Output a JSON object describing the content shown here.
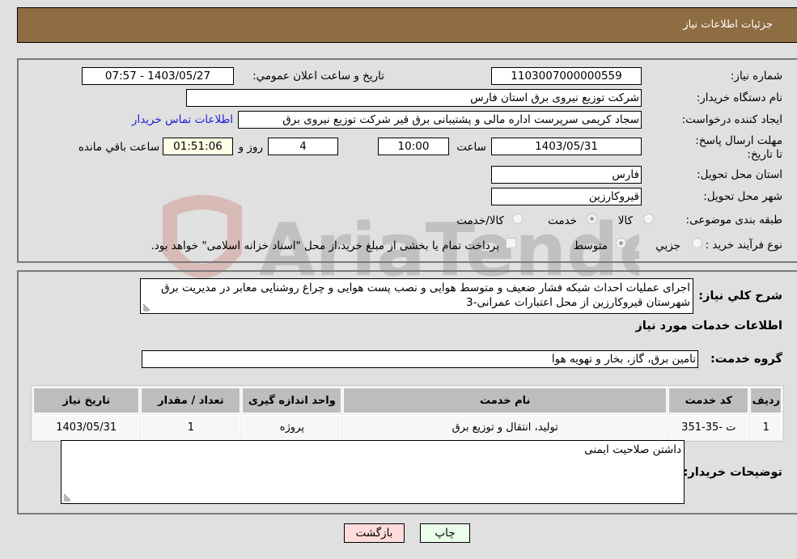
{
  "header": {
    "title": "جزئیات اطلاعات نیاز"
  },
  "form": {
    "need_number_label": "شماره نیاز:",
    "need_number": "1103007000000559",
    "announce_label": "تاريخ و ساعت اعلان عمومي:",
    "announce_value": "1403/05/27 - 07:57",
    "buyer_org_label": "نام دستگاه خریدار:",
    "buyer_org": "شرکت توزیع نیروی برق استان فارس",
    "creator_label": "ایجاد کننده درخواست:",
    "creator": "سجاد کریمی سرپرست اداره مالی و پشتیبانی برق قیر شرکت توزیع نیروی برق",
    "contact_link": "اطلاعات تماس خریدار",
    "deadline_label": "مهلت ارسال پاسخ: تا تاریخ:",
    "deadline_date": "1403/05/31",
    "time_label": "ساعت",
    "deadline_time": "10:00",
    "days_value": "4",
    "days_label": "روز و",
    "remaining_time": "01:51:06",
    "remaining_label": "ساعت باقي مانده",
    "province_label": "استان محل تحویل:",
    "province": "فارس",
    "city_label": "شهر محل تحویل:",
    "city": "قیروکارزین",
    "category_label": "طبقه بندی موضوعی:",
    "category_options": [
      {
        "label": "کالا",
        "checked": false
      },
      {
        "label": "خدمت",
        "checked": true
      },
      {
        "label": "کالا/خدمت",
        "checked": false
      }
    ],
    "process_label": "نوع فرآیند خرید :",
    "process_options": [
      {
        "label": "جزيي",
        "checked": false
      },
      {
        "label": "متوسط",
        "checked": true
      }
    ],
    "treasury_note": "پرداخت تمام یا بخشی از مبلغ خرید،از محل \"اسناد خزانه اسلامی\" خواهد بود."
  },
  "description": {
    "label": "شرح كلي نياز:",
    "text": "اجرای عملیات احداث شبکه فشار ضعیف و متوسط هوایی و نصب پست هوایی و چراغ روشنایی معابر در مدیریت برق شهرستان قیروکارزین از محل اعتبارات عمرانی-3"
  },
  "services": {
    "section_title": "اطلاعات خدمات مورد نیاز",
    "group_label": "گروه خدمت:",
    "group_value": "تامین برق، گاز، بخار و تهویه هوا",
    "table": {
      "headers": [
        "ردیف",
        "کد خدمت",
        "نام خدمت",
        "واحد اندازه گیری",
        "تعداد / مقدار",
        "تاریخ نیاز"
      ],
      "rows": [
        [
          "1",
          "ت -35-351",
          "تولید، انتقال و توزیع برق",
          "پروژه",
          "1",
          "1403/05/31"
        ]
      ]
    }
  },
  "buyer_notes": {
    "label": "توضیحات خریدار:",
    "text": "داشتن صلاحیت ایمنی"
  },
  "buttons": {
    "print": "چاپ",
    "back": "بازگشت"
  },
  "watermark": {
    "text": "AriaTender.neT"
  },
  "colors": {
    "header_bg": "#8e6d42",
    "print_bg": "#eaffea",
    "back_bg": "#ffdcdc",
    "link": "#1a1adc"
  }
}
